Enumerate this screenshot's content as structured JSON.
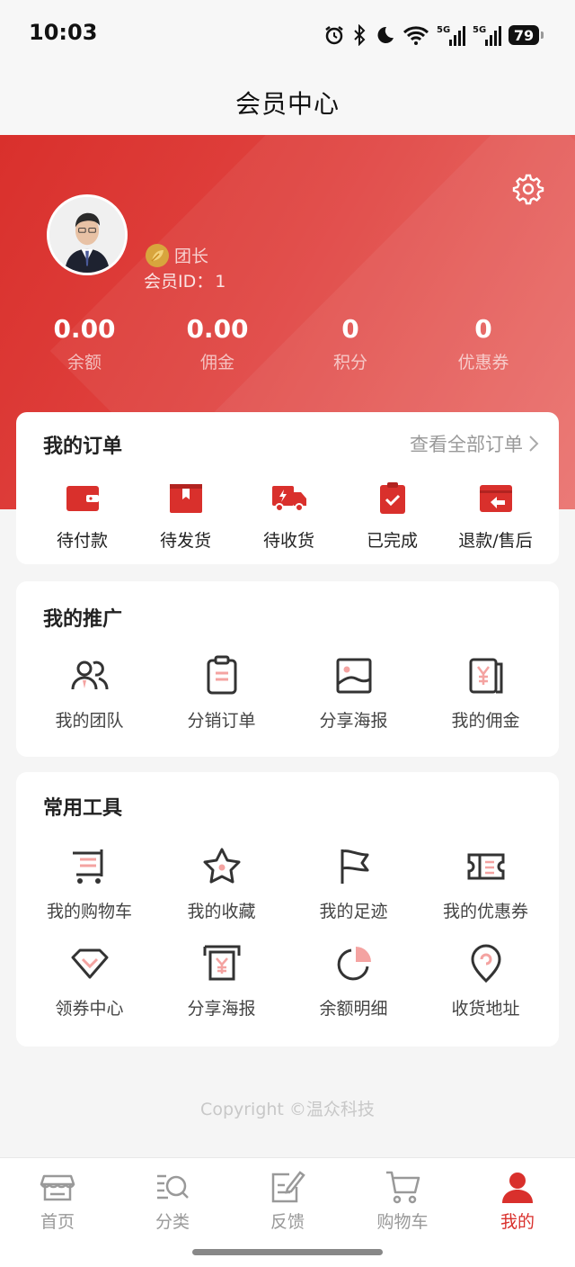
{
  "status_bar": {
    "time": "10:03",
    "battery": "79",
    "network": "5G"
  },
  "header": {
    "title": "会员中心"
  },
  "profile": {
    "role": "团长",
    "member_id_label": "会员ID：",
    "member_id": "1",
    "stats": [
      {
        "value": "0.00",
        "label": "余额"
      },
      {
        "value": "0.00",
        "label": "佣金"
      },
      {
        "value": "0",
        "label": "积分"
      },
      {
        "value": "0",
        "label": "优惠券"
      }
    ]
  },
  "orders": {
    "title": "我的订单",
    "view_all": "查看全部订单",
    "items": [
      {
        "label": "待付款",
        "icon": "wallet-icon"
      },
      {
        "label": "待发货",
        "icon": "box-icon"
      },
      {
        "label": "待收货",
        "icon": "truck-icon"
      },
      {
        "label": "已完成",
        "icon": "clipboard-check-icon"
      },
      {
        "label": "退款/售后",
        "icon": "refund-icon"
      }
    ]
  },
  "promotion": {
    "title": "我的推广",
    "items": [
      {
        "label": "我的团队",
        "icon": "team-icon"
      },
      {
        "label": "分销订单",
        "icon": "clipboard-icon"
      },
      {
        "label": "分享海报",
        "icon": "image-icon"
      },
      {
        "label": "我的佣金",
        "icon": "yen-icon"
      }
    ]
  },
  "tools": {
    "title": "常用工具",
    "items": [
      {
        "label": "我的购物车",
        "icon": "cart-icon"
      },
      {
        "label": "我的收藏",
        "icon": "star-icon"
      },
      {
        "label": "我的足迹",
        "icon": "flag-icon"
      },
      {
        "label": "我的优惠券",
        "icon": "ticket-icon"
      },
      {
        "label": "领券中心",
        "icon": "diamond-icon"
      },
      {
        "label": "分享海报",
        "icon": "poster-icon"
      },
      {
        "label": "余额明细",
        "icon": "pie-icon"
      },
      {
        "label": "收货地址",
        "icon": "location-icon"
      }
    ]
  },
  "footer": {
    "copyright": "Copyright ©温众科技"
  },
  "tabbar": {
    "items": [
      {
        "label": "首页",
        "icon": "store-icon"
      },
      {
        "label": "分类",
        "icon": "category-search-icon"
      },
      {
        "label": "反馈",
        "icon": "feedback-icon"
      },
      {
        "label": "购物车",
        "icon": "cart-icon"
      },
      {
        "label": "我的",
        "icon": "user-icon"
      }
    ],
    "active_index": 4
  },
  "colors": {
    "accent": "#d9302c",
    "accent_light": "#f4a3a1",
    "icon_dark": "#333333"
  }
}
